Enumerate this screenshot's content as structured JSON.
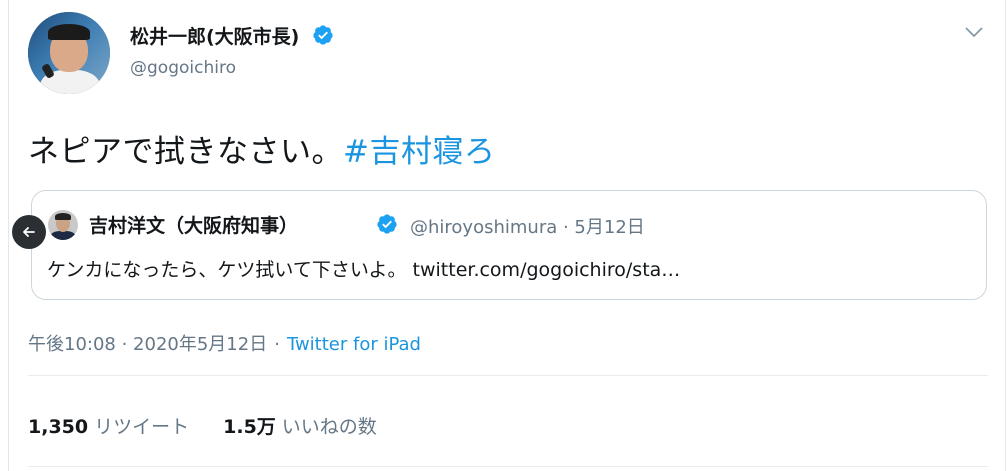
{
  "tweet": {
    "author_name": "松井一郎(大阪市長)",
    "author_handle": "@gogoichiro",
    "text": "ネピアで拭きなさい。",
    "hashtag": "#吉村寝ろ",
    "timestamp": "午後10:08 · 2020年5月12日",
    "source": "Twitter for iPad",
    "separator": "·"
  },
  "quote": {
    "author_name": "吉村洋文（大阪府知事）",
    "meta": "@hiroyoshimura · 5月12日",
    "text": "ケンカになったら、ケツ拭いて下さいよ。 twitter.com/gogoichiro/sta…"
  },
  "stats": {
    "retweets_count": "1,350",
    "retweets_label": "リツイート",
    "likes_count": "1.5万",
    "likes_label": "いいねの数"
  },
  "icons": {
    "verified": "verified-badge-icon",
    "chevron": "chevron-down-icon",
    "back": "arrow-left-icon"
  },
  "colors": {
    "accent": "#1b95e0",
    "verified": "#1da1f2",
    "muted": "#657786",
    "text": "#14171a"
  }
}
